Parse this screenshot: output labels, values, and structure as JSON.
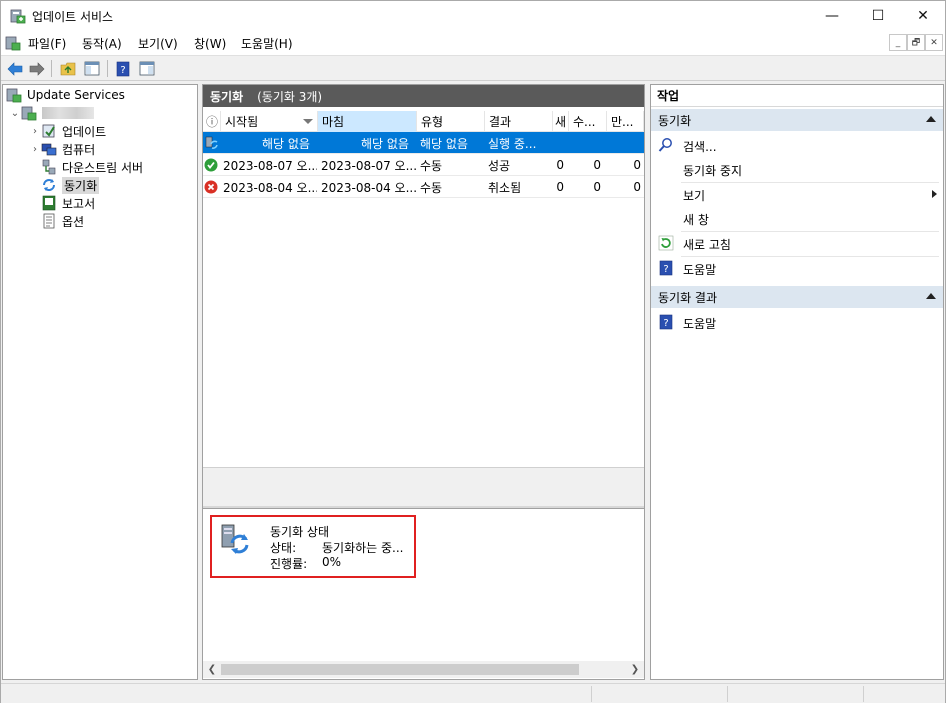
{
  "window": {
    "title": "업데이트 서비스",
    "min_glyph": "—",
    "max_glyph": "☐",
    "close_glyph": "✕"
  },
  "menu": {
    "items": [
      "파일(F)",
      "동작(A)",
      "보기(V)",
      "창(W)",
      "도움말(H)"
    ],
    "mdi_min": "_",
    "mdi_restore": "🗗",
    "mdi_close": "✕"
  },
  "tree": {
    "root_label": "Update Services",
    "children": [
      "업데이트",
      "컴퓨터",
      "다운스트림 서버",
      "동기화",
      "보고서",
      "옵션"
    ],
    "selected": "동기화"
  },
  "center": {
    "header_title": "동기화",
    "header_count": "(동기화 3개)",
    "columns": [
      "ⓘ",
      "시작됨",
      "마침",
      "유형",
      "결과",
      "새",
      "수...",
      "만..."
    ],
    "rows": [
      {
        "icon": "sync-running-icon",
        "started": "해당 없음",
        "finished": "해당 없음",
        "type": "해당 없음",
        "result": "실행 중...",
        "new": "",
        "revised": "",
        "expired": ""
      },
      {
        "icon": "success-icon",
        "started": "2023-08-07 오...",
        "finished": "2023-08-07 오...",
        "type": "수동",
        "result": "성공",
        "new": "0",
        "revised": "0",
        "expired": "0"
      },
      {
        "icon": "error-icon",
        "started": "2023-08-04 오...",
        "finished": "2023-08-04 오...",
        "type": "수동",
        "result": "취소됨",
        "new": "0",
        "revised": "0",
        "expired": "0"
      }
    ],
    "status": {
      "title": "동기화 상태",
      "state_label": "상태:",
      "state_value": "동기화하는 중...",
      "progress_label": "진행률:",
      "progress_value": "0%"
    }
  },
  "actions": {
    "header": "작업",
    "group1": "동기화",
    "group1_items": [
      "검색...",
      "동기화 중지",
      "보기",
      "새 창",
      "새로 고침",
      "도움말"
    ],
    "group2": "동기화 결과",
    "group2_items": [
      "도움말"
    ]
  },
  "colors": {
    "selection": "#0078d7",
    "panel_header": "#5a5a5a",
    "action_group": "#dce6f0",
    "highlight_border": "#e02020"
  }
}
